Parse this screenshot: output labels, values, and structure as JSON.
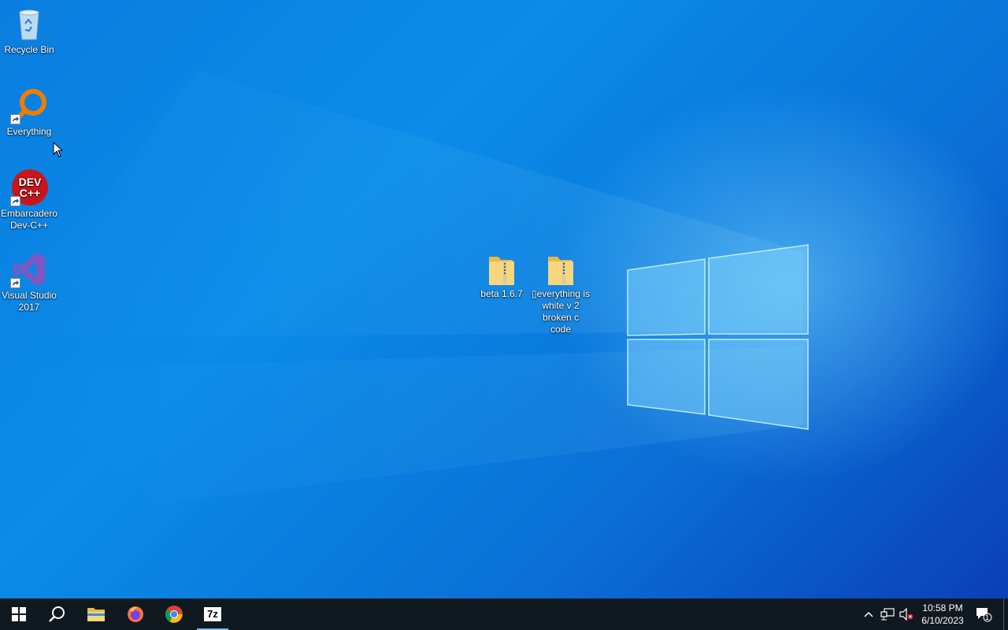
{
  "desktop": {
    "icons": [
      {
        "label": "Recycle Bin"
      },
      {
        "label": "Everything"
      },
      {
        "label": "Embarcadero Dev-C++"
      },
      {
        "label": "Visual Studio 2017"
      },
      {
        "label": "beta 1.6.7"
      },
      {
        "label": "▯everything is white v 2 broken c code"
      }
    ],
    "devcpp_logo_text": "DEV C++"
  },
  "taskbar": {
    "items": [
      "start-button",
      "search-icon",
      "file-explorer-icon",
      "firefox-icon",
      "chrome-icon",
      "7zip-icon"
    ],
    "sevenzip_label": "7z",
    "notification_count": "1",
    "clock": {
      "time": "10:58 PM",
      "date": "6/10/2023"
    }
  },
  "colors": {
    "taskbar": "#101820",
    "desktop_top": "#0a8ce8",
    "desktop_bottom": "#0a3fb8",
    "folder": "#f4d27a"
  }
}
